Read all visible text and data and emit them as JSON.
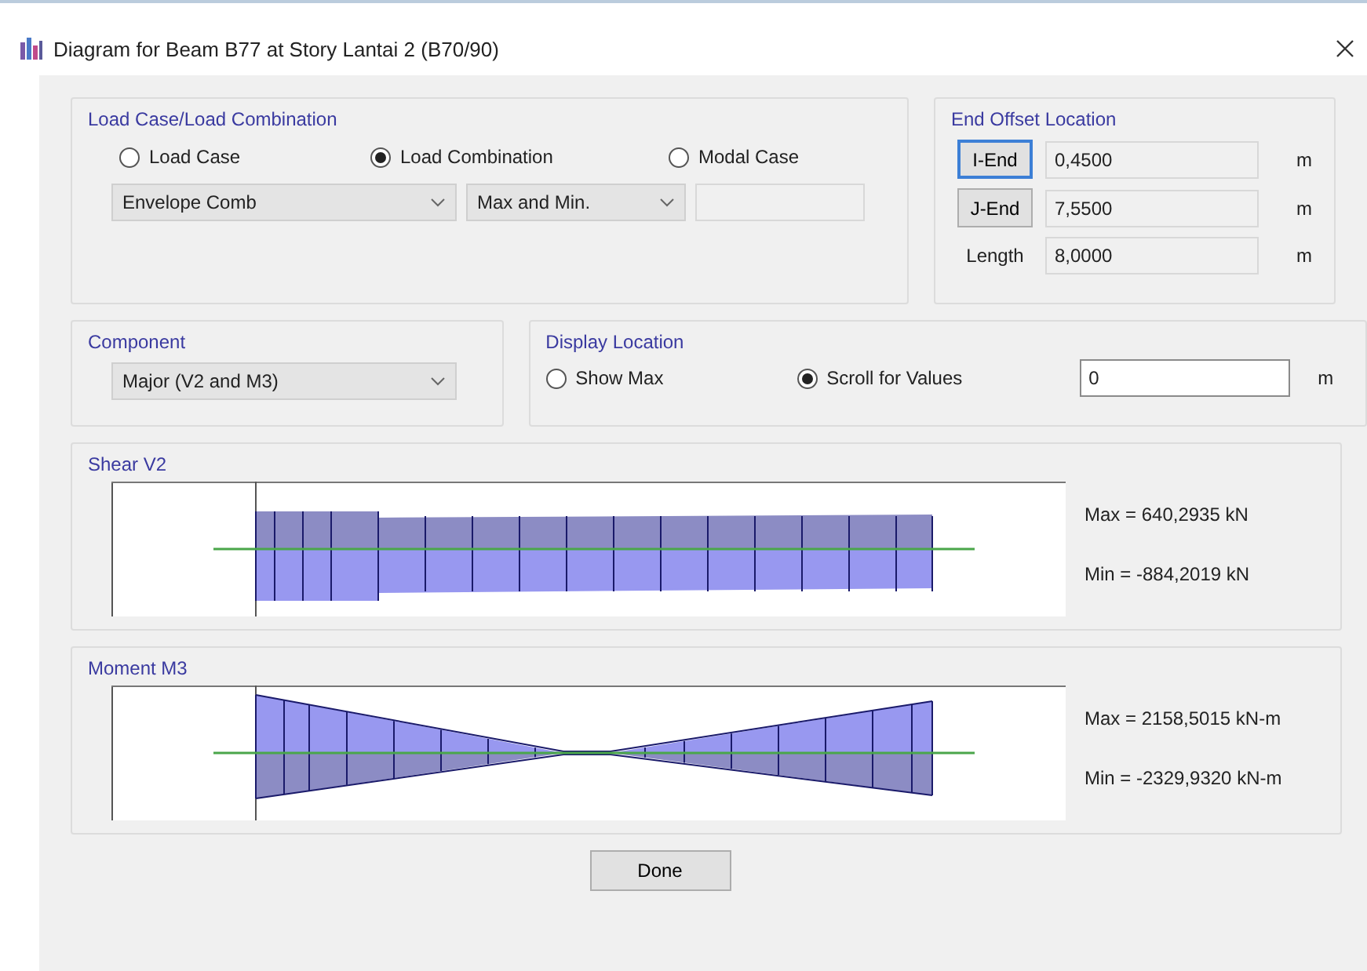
{
  "window": {
    "title": "Diagram for Beam B77 at Story Lantai 2 (B70/90)"
  },
  "load_group": {
    "title": "Load Case/Load Combination",
    "options": [
      {
        "label": "Load Case",
        "selected": false
      },
      {
        "label": "Load Combination",
        "selected": true
      },
      {
        "label": "Modal Case",
        "selected": false
      }
    ],
    "combo": "Envelope Comb",
    "mode": "Max and Min."
  },
  "end_offset": {
    "title": "End Offset Location",
    "rows": [
      {
        "kind": "button",
        "label": "I-End",
        "value": "0,4500",
        "unit": "m",
        "focused": true
      },
      {
        "kind": "button",
        "label": "J-End",
        "value": "7,5500",
        "unit": "m",
        "focused": false
      },
      {
        "kind": "label",
        "label": "Length",
        "value": "8,0000",
        "unit": "m"
      }
    ]
  },
  "component": {
    "title": "Component",
    "value": "Major (V2 and M3)"
  },
  "display_location": {
    "title": "Display Location",
    "options": [
      {
        "label": "Show Max",
        "selected": false
      },
      {
        "label": "Scroll for Values",
        "selected": true
      }
    ],
    "value": "0",
    "unit": "m"
  },
  "diagrams": [
    {
      "kind": "shear",
      "title": "Shear V2",
      "max": "Max = 640,2935 kN",
      "min": "Min = -884,2019 kN"
    },
    {
      "kind": "moment",
      "title": "Moment M3",
      "max": "Max = 2158,5015 kN-m",
      "min": "Min = -2329,9320 kN-m"
    }
  ],
  "done": "Done"
}
